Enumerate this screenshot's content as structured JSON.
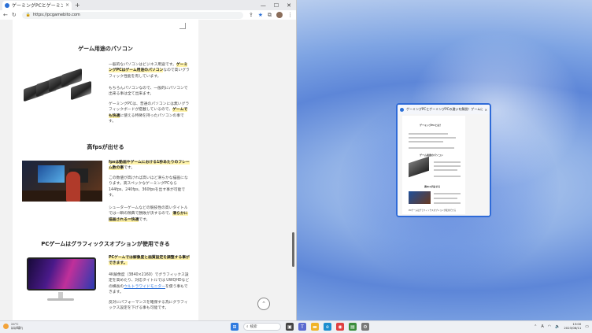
{
  "browser": {
    "tab_title": "ゲーミングPCとゲーミングPCの違いを解説！",
    "tab_close": "×",
    "new_tab": "+",
    "window_controls": [
      "—",
      "☐",
      "✕"
    ],
    "address": "https://pcgamebito.com",
    "nav": {
      "back": "←",
      "refresh": "↻"
    }
  },
  "article": {
    "h_gaming_pc": "ゲーム用途のパソコン",
    "p1_a": "一般的なパソコンはビジネス用途です。",
    "p1_hl": "ゲーミングPCはゲーム用途のパソコン",
    "p1_b": "なので高いグラフィック性能を有しています。",
    "p2": "もちろんパソコンなので、一般的にパソコンで出来る事は全て出来ます。",
    "p3_a": "ゲーミングPCは、普通のパソコンには無いグラフィックボードが搭載しているので、",
    "p3_hl": "ゲームでも快適",
    "p3_b": "に使える特徴を持ったパソコンの事です。",
    "h_fps": "高fpsが出せる",
    "p4_hl": "fpsは動画やゲームにおける1秒あたりのフレーム数の事",
    "p4_b": "です。",
    "p5": "この数値が高ければ高いほど滑らかな描画になります。高スペックなゲーミングPCなら144fps、240fps、360fpsを出す事が可能です。",
    "p6_a": "シューターゲームなどの競技性の高いタイトルでは一瞬の隙典で勝敗が決するので、",
    "p6_hl": "滑らかに描画される＝快適",
    "p6_b": "です。",
    "h_graphics": "PCゲームはグラフィックスオプションが使用できる",
    "p7_hl": "PCゲームでは解像度と画質設定を調整する事ができます。",
    "p8_a": "4K解像度（3840×2160）でグラフィックス設定を高めたり、対応タイトルでは UWQHDなどの横長の",
    "p8_link": "ウルトラワイドモニター",
    "p8_b": "を使う事もできます。",
    "p9": "反対にパフォーマンスを確保する為にグラフィックス設定を下げる事も可能です。",
    "to_top": "⌃"
  },
  "thumbnail": {
    "title": "ゲーミングPCとゲーミングPCの違いを解説！ゲームにおすすめ・プロフィール",
    "close": "×",
    "h1": "ゲーミングPCとは？",
    "h2": "ゲーム用途のパソコン",
    "h3": "高fpsが出せる",
    "footer": "PCゲームはグラフィックスオプションが使用できる"
  },
  "taskbar": {
    "weather_temp": "24°C",
    "weather_desc": "ほぼ晴れ",
    "search_placeholder": "検索",
    "time": "13:00",
    "date": "2023/06/11",
    "lang": "A"
  },
  "colors": {
    "accent": "#2f6bd8",
    "highlight": "#fff3a8",
    "link": "#2a6fd6"
  }
}
